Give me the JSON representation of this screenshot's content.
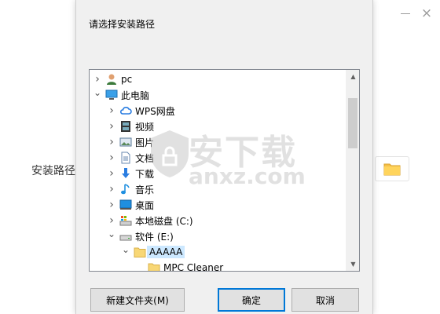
{
  "background_window": {
    "path_label": "安装路径",
    "close_glyph": "×"
  },
  "dialog": {
    "prompt": "请选择安装路径",
    "tree": [
      {
        "label": "pc",
        "icon": "user-icon",
        "depth": 0,
        "chevron": "right"
      },
      {
        "label": "此电脑",
        "icon": "computer-icon",
        "depth": 0,
        "chevron": "down"
      },
      {
        "label": "WPS网盘",
        "icon": "cloud-icon",
        "depth": 1,
        "chevron": "right"
      },
      {
        "label": "视频",
        "icon": "video-icon",
        "depth": 1,
        "chevron": "right"
      },
      {
        "label": "图片",
        "icon": "picture-icon",
        "depth": 1,
        "chevron": "right"
      },
      {
        "label": "文档",
        "icon": "document-icon",
        "depth": 1,
        "chevron": "right"
      },
      {
        "label": "下载",
        "icon": "download-icon",
        "depth": 1,
        "chevron": "right"
      },
      {
        "label": "音乐",
        "icon": "music-icon",
        "depth": 1,
        "chevron": "right"
      },
      {
        "label": "桌面",
        "icon": "desktop-icon",
        "depth": 1,
        "chevron": "right"
      },
      {
        "label": "本地磁盘 (C:)",
        "icon": "drive-c-icon",
        "depth": 1,
        "chevron": "right"
      },
      {
        "label": "软件 (E:)",
        "icon": "drive-icon",
        "depth": 1,
        "chevron": "down"
      },
      {
        "label": "AAAAA",
        "icon": "folder-icon",
        "depth": 2,
        "chevron": "down",
        "selected": true
      },
      {
        "label": "MPC Cleaner",
        "icon": "folder-icon",
        "depth": 3,
        "chevron": "none"
      }
    ],
    "buttons": {
      "new_folder": "新建文件夹(M)",
      "ok": "确定",
      "cancel": "取消"
    }
  },
  "watermark": {
    "cn": "安下载",
    "en": "anxz.com"
  },
  "colors": {
    "selection": "#cce8ff",
    "accent": "#0078d7",
    "folder": "#f8d775"
  }
}
